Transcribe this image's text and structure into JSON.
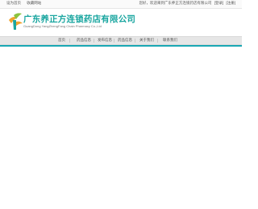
{
  "topbar": {
    "links": [
      "设为首页",
      "收藏网站"
    ],
    "greeting": "您好，欢迎来到广东养正方连锁药店有限公司",
    "auth_links": [
      "[登录]",
      "[注册]"
    ]
  },
  "logo": {
    "title": "广东养正方连锁药店有限公司",
    "subtitle": "GuangDong YangZhengFang Chain Pharmacy Co.,Ltd",
    "icon": "leaf-logo-icon"
  },
  "nav": {
    "items": [
      "首页",
      "药品信息",
      "发布信息",
      "药品信息",
      "关于我们",
      "联系我们"
    ]
  },
  "colors": {
    "accent": "#1aa6a0",
    "bar": "#19a8b4",
    "nav_bg": "#e6e6e6"
  }
}
